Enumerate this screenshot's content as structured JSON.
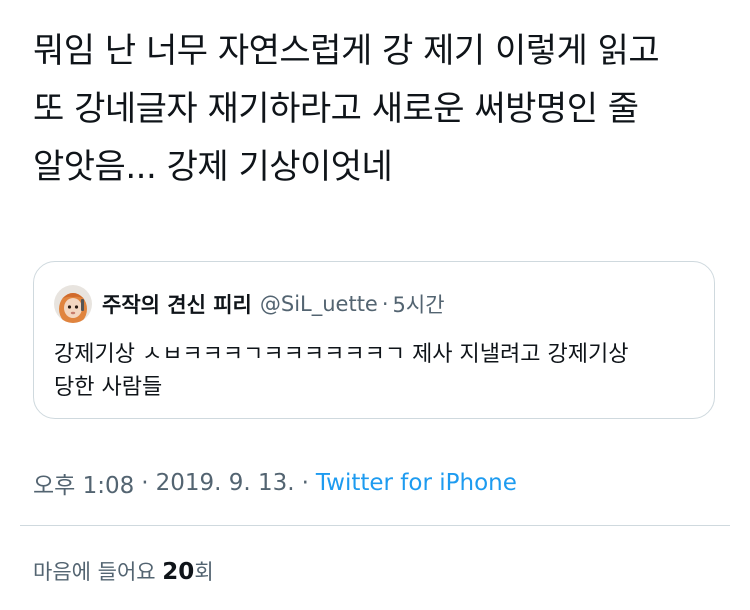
{
  "tweet": {
    "text": "뭐임 난 너무 자연스럽게 강 제기 이렇게 읽고\n또 강네글자 재기하라고 새로운 써방명인 줄\n알앗음... 강제 기상이엇네"
  },
  "quote": {
    "author_name": "주작의 견신 피리",
    "handle": "@SiL_uette",
    "separator": "·",
    "time": "5시간",
    "text": "강제기상 ㅅㅂㅋㅋㅋㄱㅋㅋㅋㅋㅋㅋㄱ 제사 지낼려고 강제기상\n당한 사람들"
  },
  "meta": {
    "time": "오후 1:08",
    "date": "2019. 9. 13.",
    "separator": "·",
    "source": "Twitter for iPhone"
  },
  "likes": {
    "prefix": "마음에 들어요",
    "count": "20",
    "suffix": "회"
  },
  "colors": {
    "text": "#0f1419",
    "secondary": "#536471",
    "link": "#1d9bf0",
    "border": "#cfd9de"
  }
}
